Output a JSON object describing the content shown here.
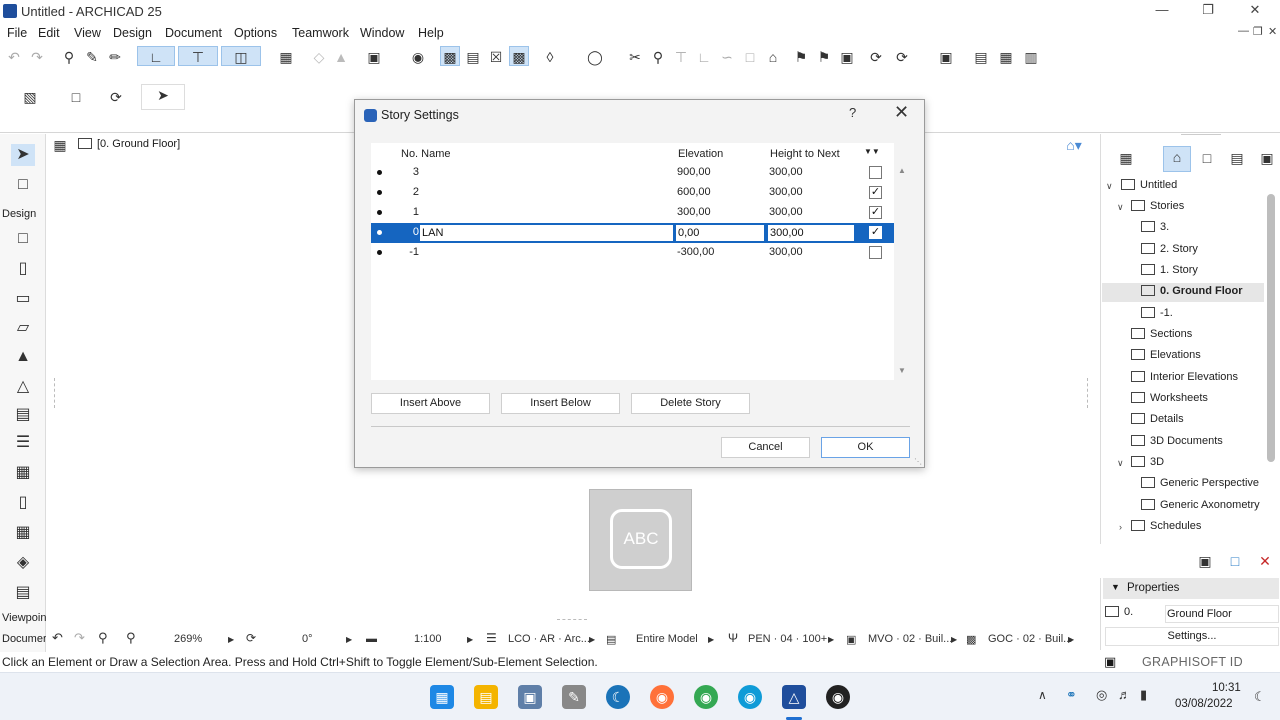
{
  "window": {
    "title": "Untitled - ARCHICAD 25"
  },
  "menu": {
    "items": [
      "File",
      "Edit",
      "View",
      "Design",
      "Document",
      "Options",
      "Teamwork",
      "Window",
      "Help"
    ]
  },
  "toolbox": {
    "design_label": "Design",
    "viewpoint_label": "Viewpoin",
    "document_label": "Documer"
  },
  "tab": {
    "label": "[0. Ground Floor]"
  },
  "navigator": {
    "items": [
      {
        "label": "Untitled",
        "level": 0
      },
      {
        "label": "Stories",
        "level": 1
      },
      {
        "label": "3.",
        "level": 2
      },
      {
        "label": "2. Story",
        "level": 2
      },
      {
        "label": "1. Story",
        "level": 2
      },
      {
        "label": "0. Ground Floor",
        "level": 2,
        "selected": true
      },
      {
        "label": "-1.",
        "level": 2
      },
      {
        "label": "Sections",
        "level": 1
      },
      {
        "label": "Elevations",
        "level": 1
      },
      {
        "label": "Interior Elevations",
        "level": 1
      },
      {
        "label": "Worksheets",
        "level": 1
      },
      {
        "label": "Details",
        "level": 1
      },
      {
        "label": "3D Documents",
        "level": 1
      },
      {
        "label": "3D",
        "level": 1
      },
      {
        "label": "Generic Perspective",
        "level": 2
      },
      {
        "label": "Generic Axonometry",
        "level": 2
      },
      {
        "label": "Schedules",
        "level": 1
      }
    ]
  },
  "properties": {
    "header": "Properties",
    "story_no": "0.",
    "story_name": "Ground Floor",
    "settings_button": "Settings..."
  },
  "dialog": {
    "title": "Story Settings",
    "help": "?",
    "columns": {
      "no_name": "No. Name",
      "elevation": "Elevation",
      "height": "Height to Next"
    },
    "rows": [
      {
        "no": "3",
        "name": "",
        "elevation": "900,00",
        "height": "300,00",
        "checked": false
      },
      {
        "no": "2",
        "name": "",
        "elevation": "600,00",
        "height": "300,00",
        "checked": true
      },
      {
        "no": "1",
        "name": "",
        "elevation": "300,00",
        "height": "300,00",
        "checked": true
      },
      {
        "no": "0",
        "name": "LAN",
        "elevation": "0,00",
        "height": "300,00",
        "checked": true,
        "selected": true
      },
      {
        "no": "-1",
        "name": "",
        "elevation": "-300,00",
        "height": "300,00",
        "checked": false
      }
    ],
    "buttons": {
      "insert_above": "Insert Above",
      "insert_below": "Insert Below",
      "delete_story": "Delete Story",
      "cancel": "Cancel",
      "ok": "OK"
    }
  },
  "viewbar": {
    "zoom": "269%",
    "angle": "0°",
    "scale": "1:100",
    "layer_combo": "LCO · AR · Arc...",
    "model_view": "Entire Model",
    "pen_set": "PEN · 04 · 100+",
    "mvo": "MVO · 02 · Buil...",
    "goc": "GOC · 02 · Buil..."
  },
  "status": {
    "message": "Click an Element or Draw a Selection Area. Press and Hold Ctrl+Shift to Toggle Element/Sub-Element Selection."
  },
  "graphisoft": {
    "label": "GRAPHISOFT ID"
  },
  "abc_icon": {
    "label": "ABC"
  },
  "taskbar": {
    "time": "10:31",
    "date": "03/08/2022"
  },
  "colors": {
    "accent": "#1565c0",
    "brand": "#1f4e9c"
  }
}
